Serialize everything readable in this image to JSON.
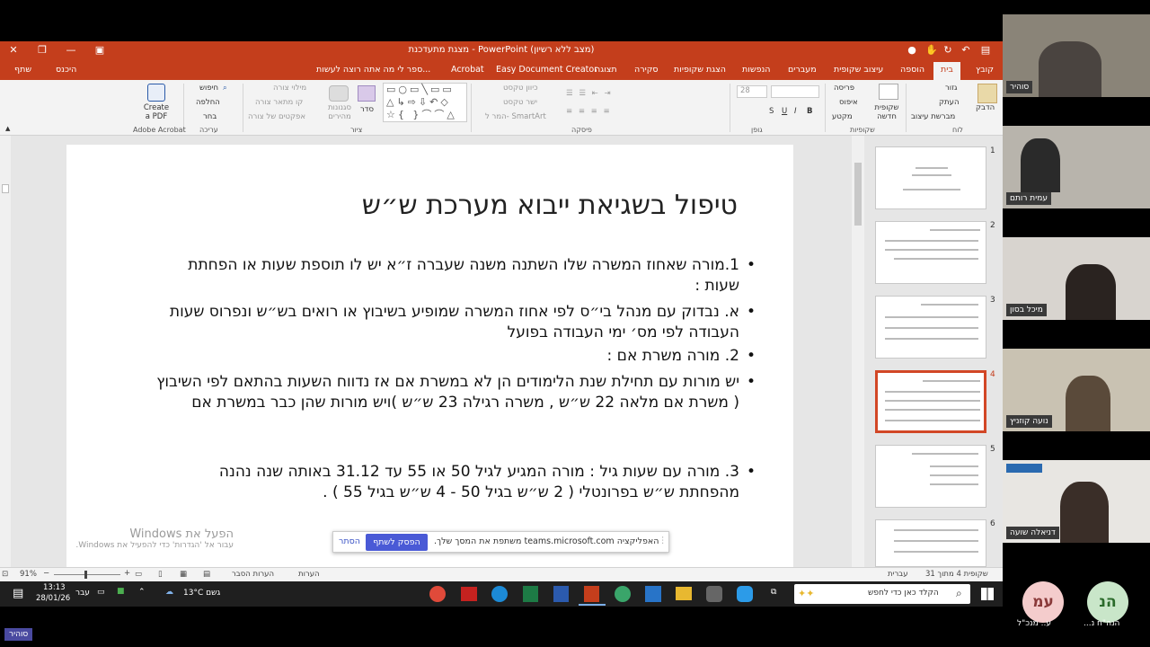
{
  "window": {
    "title": "מצגת מתעדכנת - PowerPoint (מצב ללא רשיון)"
  },
  "tabs": [
    "קובץ",
    "בית",
    "הוספה",
    "עיצוב שקופית",
    "מעברים",
    "הנפשות",
    "הצגת שקופיות",
    "סקירה",
    "תצוגה",
    "Easy Document Creator",
    "Acrobat",
    "ספר לי מה אתה רוצה לעשות...",
    "היכנס",
    "שתף"
  ],
  "ribbon": {
    "clipboard": {
      "paste": "הדבק",
      "cut": "גזור",
      "copy": "העתק",
      "format": "מברשת עיצוב",
      "label": "לוח"
    },
    "slides": {
      "new": "שקופית חדשה",
      "layout": "פריסה",
      "reset": "איפוס",
      "section": "מקטע",
      "label": "שקופיות"
    },
    "font": {
      "size": "28",
      "label": "גופן"
    },
    "paragraph": {
      "direction": "כיוון טקסט",
      "align": "ישר טקסט",
      "smartart": "המר ל- SmartArt",
      "label": "פיסקה"
    },
    "drawing": {
      "arrange": "סדר",
      "styles": "סגנונות מהירים",
      "fill": "מילוי צורה",
      "outline": "קו מתאר צורה",
      "effects": "אפקטים של צורה",
      "label": "ציור"
    },
    "editing": {
      "find": "חיפוש",
      "replace": "החלפה",
      "select": "בחר",
      "label": "עריכה"
    },
    "acrobat": {
      "create": "Create a PDF",
      "label": "Adobe Acrobat"
    }
  },
  "slide": {
    "title": "טיפול בשגיאת ייבוא מערכת ש״ש",
    "bullets": [
      "1.מורה שאחוז המשרה שלו השתנה משנה שעברה ז״א יש לו תוספת שעות או הפחתת שעות :",
      "א. נבדוק עם מנהל בי״ס לפי אחוז המשרה שמופיע בשיבוץ או רואים בש״ש ונפרוס שעות העבודה לפי מס׳ ימי העבודה בפועל",
      "2. מורה משרת אם :",
      "יש מורות עם תחילת שנת הלימודים הן לא במשרת אם אז נדווח השעות בהתאם לפי השיבוץ ( משרת אם מלאה 22 ש״ש , משרה רגילה 23 ש״ש )ויש מורות שהן כבר במשרת אם",
      "3. מורה עם שעות גיל : מורה המגיע לגיל 50 או 55 עד 31.12 באותה שנה נהנה מהפחתת ש״ש בפרונטלי ( 2 ש״ש בגיל 50 - 4 ש״ש בגיל 55 ) ."
    ]
  },
  "thumbnails": [
    "1",
    "2",
    "3",
    "4",
    "5",
    "6"
  ],
  "status": {
    "slide_of": "שקופית 4 מתוך 31",
    "lang": "עברית",
    "notes": "הערות",
    "comments": "הערות הסבר",
    "zoom": "91%"
  },
  "share_bar": {
    "text": "האפליקציה teams.microsoft.com משתפת את המסך שלך.",
    "stop": "הפסק לשתף",
    "hide": "הסתר"
  },
  "watermark": {
    "line1": "הפעל את Windows",
    "line2": "עבור אל 'הגדרות' כדי להפעיל את Windows."
  },
  "taskbar": {
    "search": "הקלד כאן כדי לחפש",
    "weather": "13°C גשם",
    "lang": "עבר",
    "time": "13:13",
    "date": "28/01/26"
  },
  "participants": [
    "סוהיר",
    "עמית רותם",
    "מיכל בסון",
    "נועה קוזניץ",
    "דניאלה שועה"
  ],
  "avatars": [
    {
      "initials": "הנ",
      "name": "הנה\"ח נ...",
      "color": "#c9e6c9"
    },
    {
      "initials": "עמ",
      "name": "ע.. מנכ\"ל",
      "color": "#f4cccc"
    }
  ],
  "bottom_label": "סוהיר"
}
